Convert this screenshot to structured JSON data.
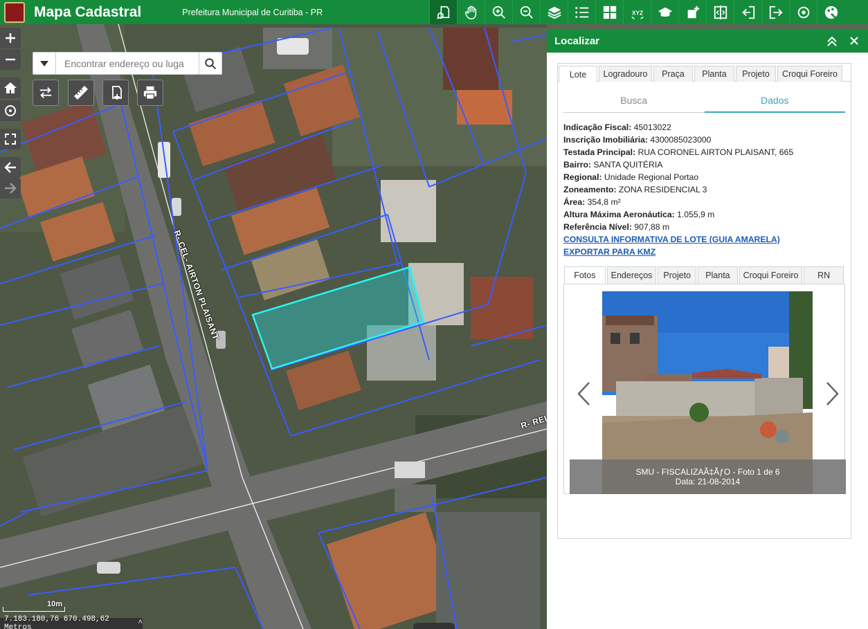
{
  "header": {
    "title": "Mapa Cadastral",
    "subtitle": "Prefeitura Municipal de Curitiba - PR",
    "tools": [
      "identify-icon",
      "pan-icon",
      "zoom-in-icon",
      "zoom-out-icon",
      "layers-icon",
      "legend-icon",
      "grid-icon",
      "xyz-icon",
      "education-icon",
      "add-layer-icon",
      "compare-icon",
      "import-icon",
      "export-icon",
      "location-icon",
      "palette-icon"
    ],
    "xyz_label": "XYZ"
  },
  "map": {
    "search_placeholder": "Encontrar endereço ou luga",
    "street_label_1": "R- CEL- AIRTON PLAISANT",
    "street_label_2": "R- REI",
    "scale_label": "10m",
    "coords": "7.183.180,76 670.498,62 Metros",
    "coords_caret": "^"
  },
  "panel": {
    "title": "Localizar",
    "tabs": [
      "Lote",
      "Logradouro",
      "Praça",
      "Planta",
      "Projeto",
      "Croqui Foreiro"
    ],
    "subtabs": [
      "Busca",
      "Dados"
    ],
    "fields": [
      {
        "label": "Indicação Fiscal:",
        "value": "45013022"
      },
      {
        "label": "Inscrição Imobiliária:",
        "value": "4300085023000"
      },
      {
        "label": "Testada Principal:",
        "value": "RUA CORONEL AIRTON PLAISANT, 665"
      },
      {
        "label": "Bairro:",
        "value": "SANTA QUITÉRIA"
      },
      {
        "label": "Regional:",
        "value": "Unidade Regional Portao"
      },
      {
        "label": "Zoneamento:",
        "value": "ZONA RESIDENCIAL 3"
      },
      {
        "label": "Área:",
        "value": "354,8 m²"
      },
      {
        "label": "Altura Máxima Aeronáutica:",
        "value": "1.055,9 m"
      },
      {
        "label": "Referência Nível:",
        "value": "907,88 m"
      }
    ],
    "link_consulta": "CONSULTA INFORMATIVA DE LOTE (GUIA AMARELA)",
    "link_kmz": "EXPORTAR PARA KMZ",
    "photo_tabs": [
      "Fotos",
      "Endereços",
      "Projeto",
      "Planta",
      "Croqui Foreiro",
      "RN"
    ],
    "photo_caption_line1": "SMU - FISCALIZAÃ‡ÃƒO - Foto 1 de 6",
    "photo_caption_line2": "Data: 21-08-2014"
  }
}
